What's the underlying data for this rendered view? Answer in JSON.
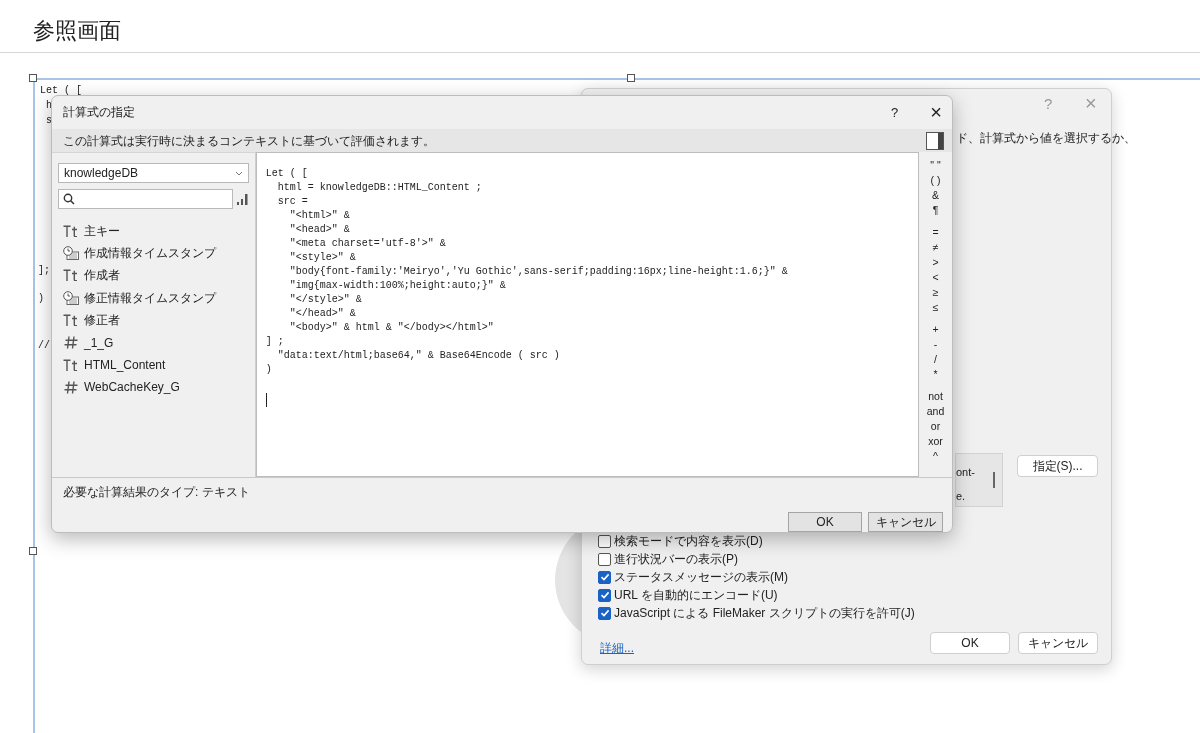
{
  "page_title": "参照画面",
  "background_code_fragments": [
    "Let ( [",
    "h",
    "s",
    "];",
    ")",
    "//"
  ],
  "web_viewer_dialog": {
    "help": "?",
    "close": "×",
    "instruction": "ド、計算式から値を選択するか、",
    "preview_fragments": [
      "ont-",
      "e."
    ],
    "specify_button": "指定(S)...",
    "options": [
      {
        "label": "検索モードで内容を表示(D)",
        "checked": false
      },
      {
        "label": "進行状況バーの表示(P)",
        "checked": false
      },
      {
        "label": "ステータスメッセージの表示(M)",
        "checked": true
      },
      {
        "label": "URL を自動的にエンコード(U)",
        "checked": true
      },
      {
        "label": "JavaScript による FileMaker スクリプトの実行を許可(J)",
        "checked": true
      }
    ],
    "details_link": "詳細...",
    "buttons": [
      "OK",
      "キャンセル"
    ]
  },
  "calculation_dialog": {
    "title": "計算式の指定",
    "help": "?",
    "close": "×",
    "context_note": "この計算式は実行時に決まるコンテキストに基づいて評価されます。",
    "table_select": "knowledgeDB",
    "fields": [
      {
        "kind": "text",
        "name": "主キー"
      },
      {
        "kind": "timestamp",
        "name": "作成情報タイムスタンプ"
      },
      {
        "kind": "text",
        "name": "作成者"
      },
      {
        "kind": "timestamp",
        "name": "修正情報タイムスタンプ"
      },
      {
        "kind": "text",
        "name": "修正者"
      },
      {
        "kind": "number",
        "name": "_1_G"
      },
      {
        "kind": "text",
        "name": "HTML_Content"
      },
      {
        "kind": "number",
        "name": "WebCacheKey_G"
      }
    ],
    "formula": [
      "Let ( [",
      "  html = knowledgeDB::HTML_Content ;",
      "  src =",
      "    \"<html>\" &",
      "    \"<head>\" &",
      "    \"<meta charset='utf-8'>\" &",
      "    \"<style>\" &",
      "    \"body{font-family:'Meiryo','Yu Gothic',sans-serif;padding:16px;line-height:1.6;}\" &",
      "    \"img{max-width:100%;height:auto;}\" &",
      "    \"</style>\" &",
      "    \"</head>\" &",
      "    \"<body>\" & html & \"</body></html>\"",
      "] ;",
      "  \"data:text/html;base64,\" & Base64Encode ( src )",
      ")"
    ],
    "operators": [
      [
        "\" \"",
        "( )",
        "&",
        "¶"
      ],
      [
        "=",
        "≠",
        ">",
        "<",
        "≥",
        "≤"
      ],
      [
        "+",
        "-",
        "/",
        "*"
      ],
      [
        "not",
        "and",
        "or",
        "xor",
        "^"
      ]
    ],
    "result_type": "必要な計算結果のタイプ: テキスト",
    "buttons": [
      "OK",
      "キャンセル"
    ]
  }
}
